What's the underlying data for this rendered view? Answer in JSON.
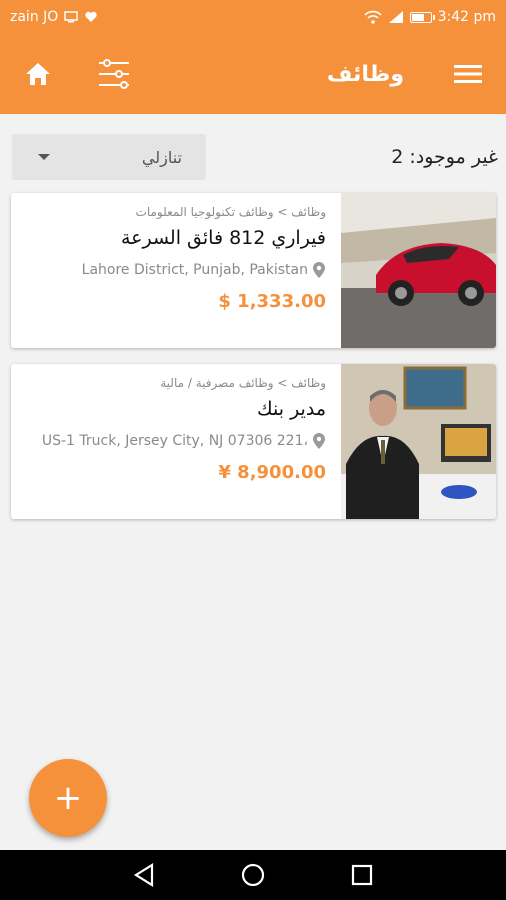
{
  "status_bar": {
    "carrier": "zain JO",
    "time": "3:42 pm"
  },
  "app_bar": {
    "title": "وظائف",
    "icons": {
      "home": "home-icon",
      "filter": "sliders-icon",
      "menu": "hamburger-menu-icon"
    }
  },
  "toolbar": {
    "results_count": "غير موجود: 2",
    "sort_value": "تنازلي"
  },
  "listings": [
    {
      "breadcrumb": "وظائف > وظائف تكنولوجيا المعلومات",
      "title": "فيراري 812 فائق السرعة",
      "location": "Lahore District, Punjab, Pakistan",
      "price": "$ 1,333.00",
      "image": "red-sports-car"
    },
    {
      "breadcrumb": "وظائف > وظائف مصرفية / مالية",
      "title": "مدير بنك",
      "location": "US-1 Truck, Jersey City, NJ 07306 221،",
      "price": "¥ 8,900.00",
      "image": "man-in-office-suit"
    }
  ],
  "fab": {
    "label": "+"
  },
  "colors": {
    "accent": "#f6913b",
    "background": "#f2f2f2",
    "muted": "#8a8a8a"
  }
}
